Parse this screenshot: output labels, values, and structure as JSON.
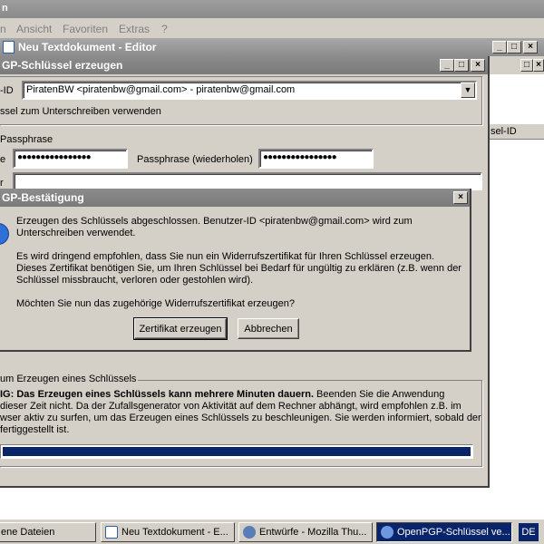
{
  "explorer": {
    "title": "n",
    "menu": [
      "n",
      "Ansicht",
      "Favoriten",
      "Extras",
      "?"
    ]
  },
  "editor": {
    "title": "Neu Textdokument - Editor",
    "column_header": "sel-ID"
  },
  "keygen": {
    "title": "GP-Schlüssel erzeugen",
    "user_id_label": "-ID",
    "user_id_value": "PiratenBW <piratenbw@gmail.com> - piratenbw@gmail.com",
    "sign_checkbox_label": "ssel zum Unterschreiben verwenden",
    "passphrase_group": "Passphrase",
    "passphrase_label": "e",
    "passphrase_value": "●●●●●●●●●●●●●●●●",
    "passphrase_repeat_label": "Passphrase (wiederholen)",
    "passphrase_repeat_value": "●●●●●●●●●●●●●●●●",
    "comment_label": "r",
    "progress_group": "um Erzeugen eines Schlüssels",
    "warning_bold": "IG: Das Erzeugen eines Schlüssels kann mehrere Minuten dauern.",
    "warning_text_1": " Beenden Sie die Anwendung",
    "warning_lines": [
      "dieser Zeit nicht. Da der Zufallsgenerator von Aktivität auf dem Rechner abhängt, wird empfohlen z.B. im",
      "wser aktiv zu surfen, um das Erzeugen eines Schlüssels zu beschleunigen. Sie werden informiert, sobald der",
      " fertiggestellt ist."
    ],
    "progress": 1.0
  },
  "confirm": {
    "title": "GP-Bestätigung",
    "line1": "Erzeugen des Schlüssels abgeschlossen. Benutzer-ID <piratenbw@gmail.com> wird zum",
    "line2": "Unterschreiben verwendet.",
    "para2_1": "Es wird dringend empfohlen, dass Sie nun ein Widerrufszertifikat für Ihren Schlüssel erzeugen.",
    "para2_2": "Dieses Zertifikat benötigen Sie, um Ihren Schlüssel bei Bedarf für ungültig zu erklären (z.B. wenn der",
    "para2_3": "Schlüssel missbraucht, verloren oder gestohlen wird).",
    "question": "Möchten Sie nun das zugehörige Widerrufszertifikat erzeugen?",
    "create_button": "Zertifikat erzeugen",
    "cancel_button": "Abbrechen"
  },
  "taskbar": {
    "items": [
      {
        "label": "ene Dateien"
      },
      {
        "label": "Neu Textdokument - E..."
      },
      {
        "label": "Entwürfe - Mozilla Thu..."
      },
      {
        "label": "OpenPGP-Schlüssel ve..."
      }
    ],
    "language": "DE"
  },
  "colors": {
    "progress_fill": "#0a246a",
    "title_inactive": "#8c8c8c",
    "task_active": "#0a246a",
    "info_icon": "#2f6fd8"
  }
}
